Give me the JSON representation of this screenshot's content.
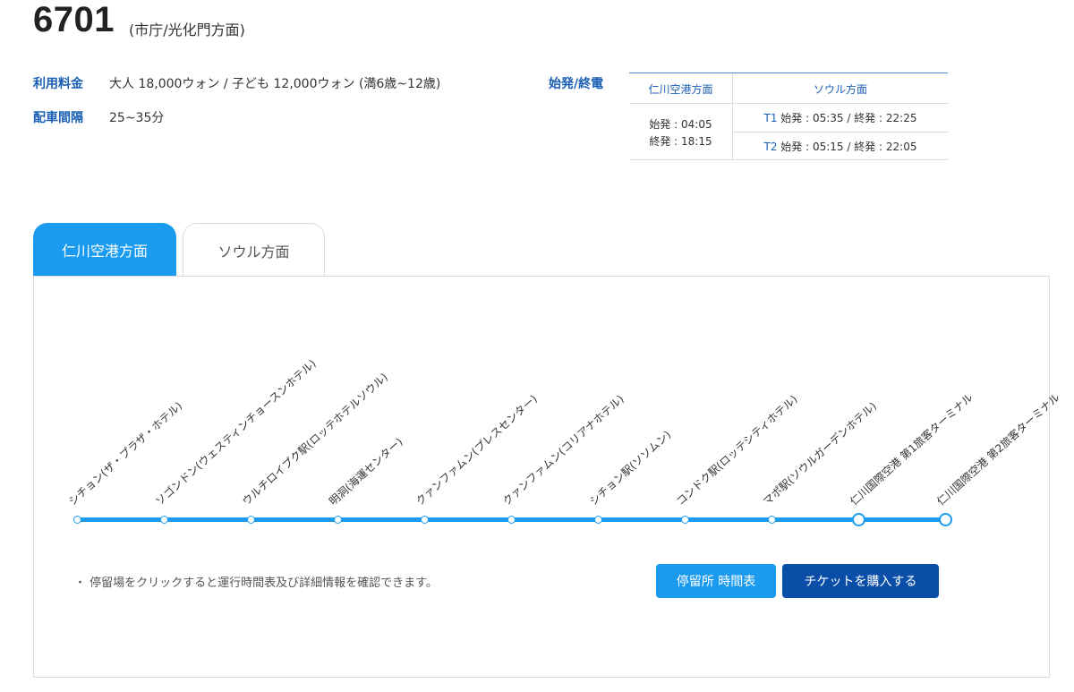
{
  "header": {
    "route_number": "6701",
    "direction": "(市庁/光化門方面)"
  },
  "info": {
    "fare_label": "利用料金",
    "fare_value": "大人 18,000ウォン / 子ども 12,000ウォン (満6歳~12歳)",
    "interval_label": "配車間隔",
    "interval_value": "25~35分"
  },
  "first_last": {
    "label": "始発/終電",
    "col1_header": "仁川空港方面",
    "col2_header": "ソウル方面",
    "col1_first": "始発 : 04:05",
    "col1_last": "終発 : 18:15",
    "t1_tag": "T1",
    "t1_times": " 始発 : 05:35 / 終発 : 22:25",
    "t2_tag": "T2",
    "t2_times": " 始発 : 05:15 / 終発 : 22:05"
  },
  "tabs": [
    {
      "label": "仁川空港方面",
      "active": true
    },
    {
      "label": "ソウル方面",
      "active": false
    }
  ],
  "stops": [
    "シチョン(ザ・プラザ・ホテル)",
    "ソゴンドン(ウェスティンチョースンホテル)",
    "ウルチロイプク駅(ロッテホテルソウル)",
    "明洞(海運センター)",
    "クァンファムン(プレスセンター)",
    "クァンファムン(コリアナホテル)",
    "シチョン駅(ソソムン)",
    "コンドク駅(ロッテシティホテル)",
    "マポ駅(ソウルガーデンホテル)",
    "仁川国際空港 第1旅客ターミナル",
    "仁川国際空港 第2旅客ターミナル"
  ],
  "note": "・ 停留場をクリックすると運行時間表及び詳細情報を確認できます。",
  "buttons": {
    "timetable": "停留所 時間表",
    "ticket": "チケットを購入する"
  },
  "colors": {
    "accent": "#1a9bf0",
    "dark_button": "#0a4ea8",
    "label_blue": "#1a5fb4"
  }
}
